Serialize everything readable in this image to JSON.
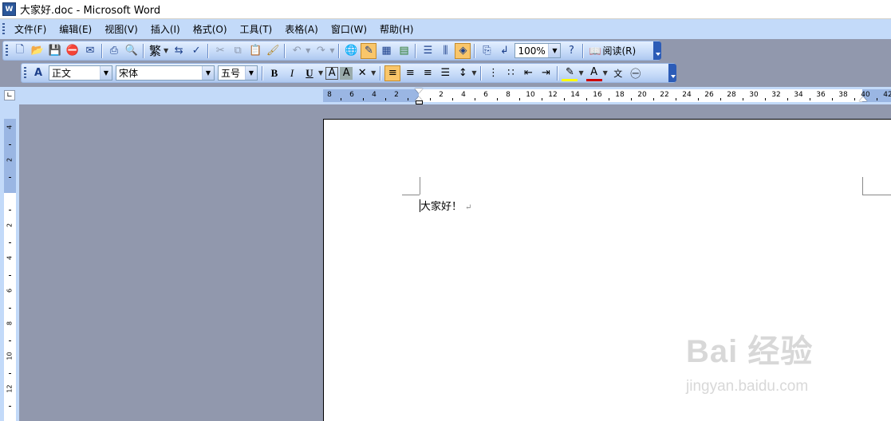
{
  "window": {
    "title": "大家好.doc - Microsoft Word",
    "app_icon": "word-doc-icon"
  },
  "menubar": {
    "items": [
      "文件(F)",
      "编辑(E)",
      "视图(V)",
      "插入(I)",
      "格式(O)",
      "工具(T)",
      "表格(A)",
      "窗口(W)",
      "帮助(H)"
    ]
  },
  "toolbar_standard": {
    "zoom": "100%",
    "read_label": "阅读(R)",
    "traditional_label": "繁"
  },
  "toolbar_formatting": {
    "style": "正文",
    "font": "宋体",
    "size": "五号"
  },
  "ruler": {
    "h_labels_left": [
      "8",
      "6",
      "4",
      "2"
    ],
    "h_labels_right": [
      "2",
      "4",
      "6",
      "8",
      "10",
      "12",
      "14",
      "16",
      "18",
      "20",
      "22",
      "24",
      "26",
      "28",
      "30",
      "32",
      "34",
      "36",
      "38",
      "40",
      "42"
    ],
    "v_labels_top": [
      "4",
      "2"
    ],
    "v_labels_bottom": [
      "2",
      "4",
      "6",
      "8",
      "10",
      "12"
    ]
  },
  "document": {
    "text": "大家好！"
  },
  "watermark": {
    "logo": "Bai 经验",
    "url": "jingyan.baidu.com"
  },
  "colors": {
    "menubar": "#c3daf9",
    "workspace": "#9198ad",
    "active_button": "#f9c66a"
  }
}
